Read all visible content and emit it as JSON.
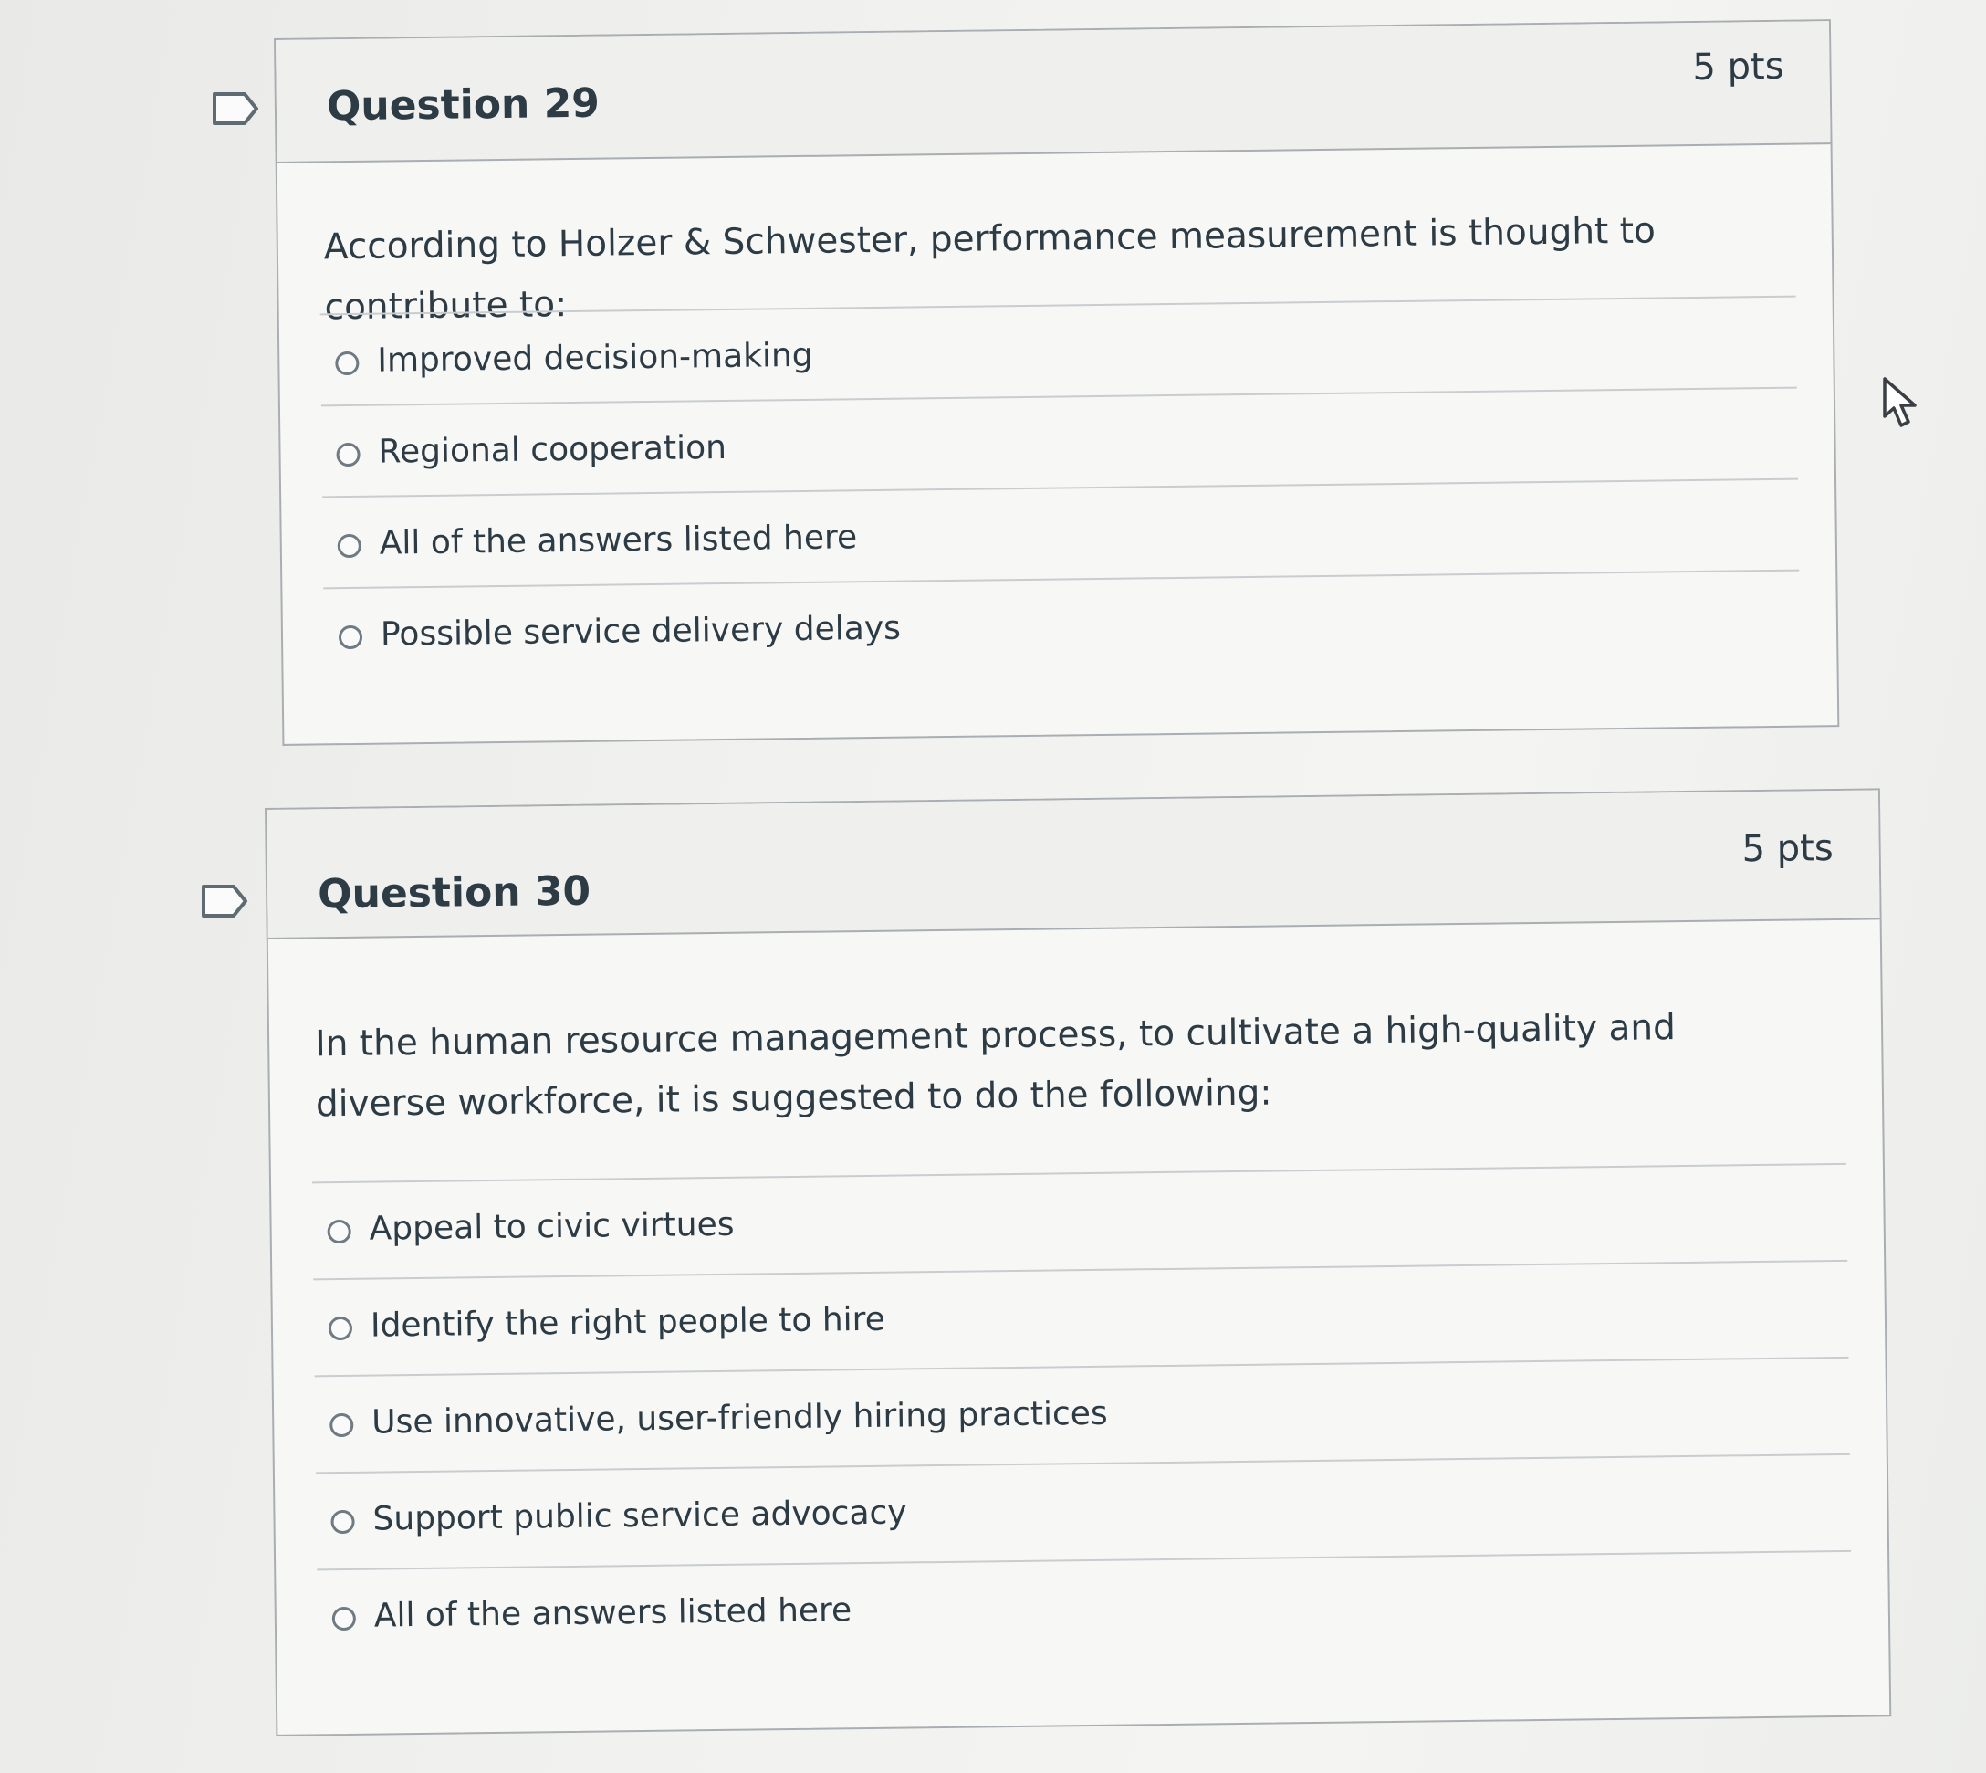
{
  "questions": [
    {
      "title": "Question 29",
      "points": "5 pts",
      "text": "According to Holzer & Schwester, performance measurement is thought to contribute to:",
      "answers": [
        "Improved decision-making",
        "Regional cooperation",
        "All of the answers listed here",
        "Possible service delivery delays"
      ]
    },
    {
      "title": "Question 30",
      "points": "5 pts",
      "text": "In the human resource management process, to cultivate a high-quality and diverse workforce, it is suggested to do the following:",
      "answers": [
        "Appeal to civic virtues",
        "Identify the right people to hire",
        "Use innovative, user-friendly hiring practices",
        "Support public service advocacy",
        "All of the answers listed here"
      ]
    }
  ],
  "icons": {
    "flag": "flag-question-icon",
    "radio": "radio-button-icon",
    "cursor": "mouse-pointer-icon"
  },
  "colors": {
    "text": "#2d3b45",
    "border": "#a9aeb2",
    "background": "#f7f7f6"
  }
}
